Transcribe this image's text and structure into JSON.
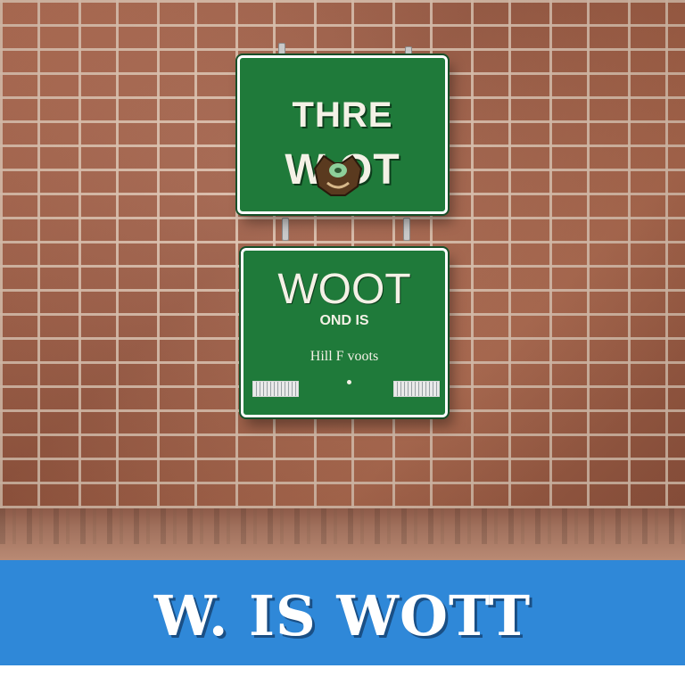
{
  "top_sign": {
    "line1": "THRE",
    "line2": "W   OT"
  },
  "bottom_sign": {
    "line1": "WOOT",
    "line2": "OND IS",
    "line3": "Hill F voots"
  },
  "banner": {
    "text": "W. IS WOTT"
  },
  "colors": {
    "sign_green": "#1f7a3a",
    "brick": "#a8644a",
    "banner_blue": "#2f88d8"
  }
}
